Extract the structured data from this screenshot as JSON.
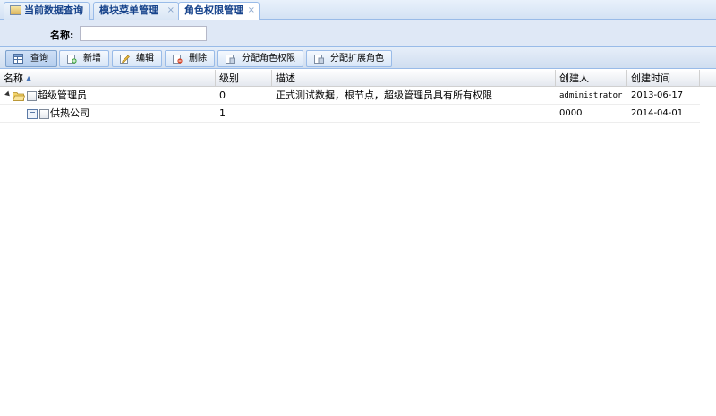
{
  "tabs": [
    {
      "label": "当前数据查询",
      "closable": false,
      "active": false,
      "icon": "home-icon"
    },
    {
      "label": "模块菜单管理",
      "closable": true,
      "active": false
    },
    {
      "label": "角色权限管理",
      "closable": true,
      "active": true
    }
  ],
  "close_glyph": "×",
  "filter": {
    "name_label": "名称:",
    "name_value": "",
    "name_placeholder": ""
  },
  "toolbar": {
    "query": "查询",
    "add": "新增",
    "edit": "编辑",
    "delete": "删除",
    "assign_role_permissions": "分配角色权限",
    "assign_extended_roles": "分配扩展角色"
  },
  "grid": {
    "columns": [
      "名称",
      "级别",
      "描述",
      "创建人",
      "创建时间"
    ],
    "sort_indicator": "▲",
    "rows": [
      {
        "name": "超级管理员",
        "level": "0",
        "description": "正式测试数据，根节点，超级管理员具有所有权限",
        "creator": "administrator",
        "created": "2013-06-17",
        "type": "folder",
        "expanded": true
      },
      {
        "name": "供热公司",
        "level": "1",
        "description": "",
        "creator": "0000",
        "created": "2014-04-01",
        "type": "leaf"
      }
    ]
  },
  "colors": {
    "header_blue": "#15428b",
    "border": "#99bbe8",
    "panel_bg": "#dfe8f6"
  }
}
